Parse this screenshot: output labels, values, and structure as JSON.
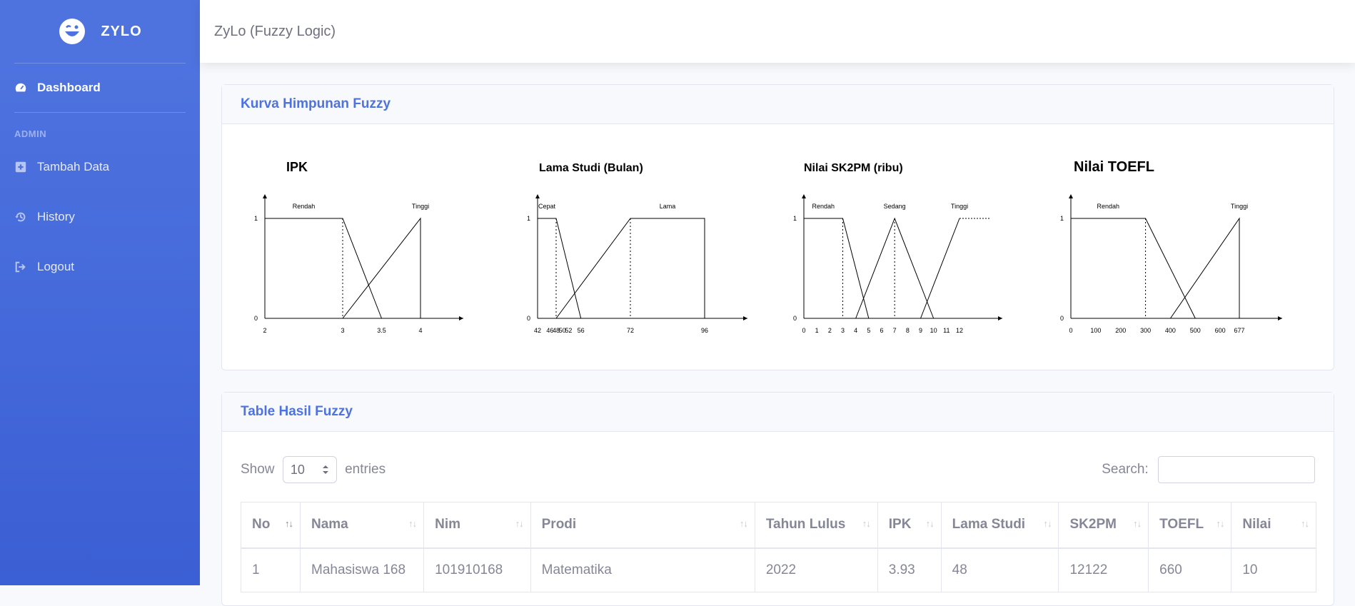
{
  "brand": {
    "name": "ZYLO"
  },
  "sidebar": {
    "items": [
      {
        "label": "Dashboard",
        "icon": "tachometer-icon"
      },
      {
        "label": "Tambah Data",
        "icon": "plus-square-icon"
      },
      {
        "label": "History",
        "icon": "history-icon"
      },
      {
        "label": "Logout",
        "icon": "sign-out-icon"
      }
    ],
    "heading": "ADMIN"
  },
  "topbar": {
    "title": "ZyLo (Fuzzy Logic)"
  },
  "curves_card": {
    "title": "Kurva Himpunan Fuzzy"
  },
  "table_card": {
    "title": "Table Hasil Fuzzy"
  },
  "datatable": {
    "show_label": "Show",
    "entries_label": "entries",
    "page_length": "10",
    "search_label": "Search:",
    "search_value": "",
    "columns": [
      "No",
      "Nama",
      "Nim",
      "Prodi",
      "Tahun Lulus",
      "IPK",
      "Lama Studi",
      "SK2PM",
      "TOEFL",
      "Nilai"
    ],
    "rows": [
      [
        "1",
        "Mahasiswa 168",
        "101910168",
        "Matematika",
        "2022",
        "3.93",
        "48",
        "12122",
        "660",
        "10"
      ]
    ]
  },
  "colors": {
    "accent": "#4e73df",
    "text_muted": "#858796"
  },
  "chart_data": [
    {
      "type": "line",
      "title": "IPK",
      "yticks": [
        "1",
        "0"
      ],
      "xticks": [
        "2",
        "3",
        "3.5",
        "4"
      ],
      "series": [
        {
          "name": "Rendah",
          "x": [
            2,
            3,
            3.5
          ],
          "y": [
            1,
            1,
            0
          ]
        },
        {
          "name": "Tinggi",
          "x": [
            3,
            4,
            4
          ],
          "y": [
            0,
            1,
            0
          ]
        }
      ],
      "xlim": [
        2,
        4
      ]
    },
    {
      "type": "line",
      "title": "Lama Studi (Bulan)",
      "yticks": [
        "1",
        "0"
      ],
      "xticks": [
        "42",
        "46",
        "48",
        "50",
        "52",
        "56",
        "72",
        "96"
      ],
      "series": [
        {
          "name": "Cepat",
          "x": [
            42,
            48,
            56
          ],
          "y": [
            1,
            1,
            0
          ]
        },
        {
          "name": "Lama",
          "x": [
            48,
            72,
            96,
            96
          ],
          "y": [
            0,
            1,
            1,
            0
          ]
        }
      ],
      "xlim": [
        42,
        96
      ]
    },
    {
      "type": "line",
      "title": "Nilai SK2PM (ribu)",
      "yticks": [
        "1",
        "0"
      ],
      "xticks": [
        "0",
        "1",
        "2",
        "3",
        "4",
        "5",
        "6",
        "7",
        "8",
        "9",
        "10",
        "11",
        "12"
      ],
      "series": [
        {
          "name": "Rendah",
          "x": [
            0,
            3,
            5
          ],
          "y": [
            1,
            1,
            0
          ]
        },
        {
          "name": "Sedang",
          "x": [
            4,
            7,
            10
          ],
          "y": [
            0,
            1,
            0
          ]
        },
        {
          "name": "Tinggi",
          "x": [
            9,
            12
          ],
          "y": [
            0,
            1
          ]
        }
      ],
      "xlim": [
        0,
        12
      ]
    },
    {
      "type": "line",
      "title": "Nilai TOEFL",
      "yticks": [
        "1",
        "0"
      ],
      "xticks": [
        "0",
        "100",
        "200",
        "300",
        "400",
        "500",
        "600",
        "677"
      ],
      "series": [
        {
          "name": "Rendah",
          "x": [
            0,
            300,
            500
          ],
          "y": [
            1,
            1,
            0
          ]
        },
        {
          "name": "Tinggi",
          "x": [
            400,
            677,
            677
          ],
          "y": [
            0,
            1,
            0
          ]
        }
      ],
      "xlim": [
        0,
        677
      ]
    }
  ]
}
